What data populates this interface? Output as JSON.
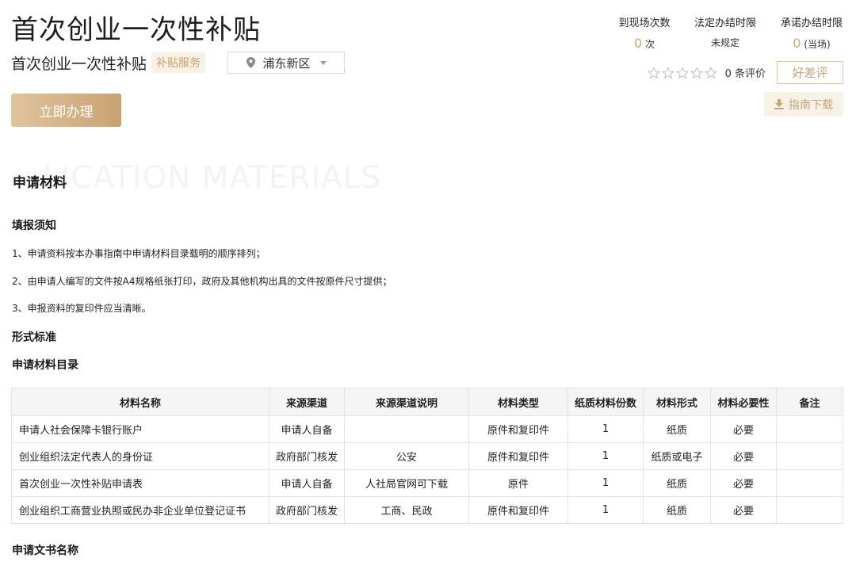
{
  "header": {
    "title": "首次创业一次性补贴",
    "subtitle": "首次创业一次性补贴",
    "tag": "补贴服务",
    "region": "浦东新区",
    "apply_button": "立即办理"
  },
  "stats": [
    {
      "label": "到现场次数",
      "value": "0",
      "unit": "次"
    },
    {
      "label": "法定办结时限",
      "value": "未规定",
      "unit": ""
    },
    {
      "label": "承诺办结时限",
      "value": "0",
      "unit": "(当场)"
    }
  ],
  "rating": {
    "stars": 5,
    "star_value": 0,
    "count_text": "0 条评价",
    "review_button": "好差评"
  },
  "download_button": "指南下载",
  "section": {
    "bg_text": "LICATION MATERIALS",
    "title": "申请材料"
  },
  "notice": {
    "title": "填报须知",
    "items": [
      "1、申请资料按本办事指南中申请材料目录载明的顺序排列；",
      "2、由申请人编写的文件按A4规格纸张打印，政府及其他机构出具的文件按原件尺寸提供；",
      "3、申报资料的复印件应当清晰。"
    ]
  },
  "format_title": "形式标准",
  "catalog_title": "申请材料目录",
  "table": {
    "headers": [
      "材料名称",
      "来源渠道",
      "来源渠道说明",
      "材料类型",
      "纸质材料份数",
      "材料形式",
      "材料必要性",
      "备注"
    ],
    "rows": [
      [
        "申请人社会保障卡银行账户",
        "申请人自备",
        "",
        "原件和复印件",
        "1",
        "纸质",
        "必要",
        ""
      ],
      [
        "创业组织法定代表人的身份证",
        "政府部门核发",
        "公安",
        "原件和复印件",
        "1",
        "纸质或电子",
        "必要",
        ""
      ],
      [
        "首次创业一次性补贴申请表",
        "申请人自备",
        "人社局官网可下载",
        "原件",
        "1",
        "纸质",
        "必要",
        ""
      ],
      [
        "创业组织工商营业执照或民办非企业单位登记证书",
        "政府部门核发",
        "工商、民政",
        "原件和复印件",
        "1",
        "纸质",
        "必要",
        ""
      ]
    ]
  },
  "docs_title": "申请文书名称",
  "colors": {
    "accent": "#c6a478",
    "tag_bg": "#f7f1e6"
  }
}
